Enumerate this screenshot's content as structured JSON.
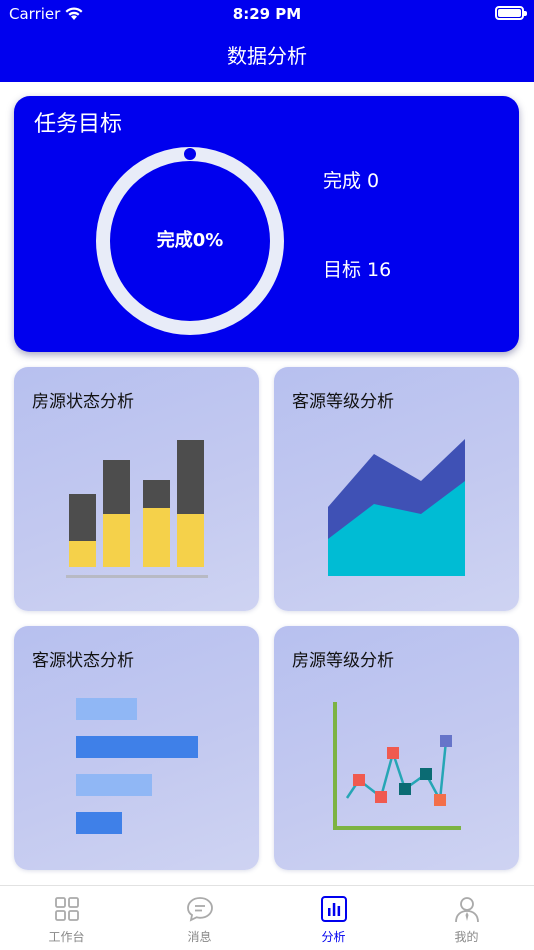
{
  "status_bar": {
    "carrier": "Carrier",
    "time": "8:29 PM"
  },
  "nav": {
    "title": "数据分析"
  },
  "colors": {
    "primary": "#0000ee",
    "card_bg": "#c3c9f0",
    "ring": "#e8ecf8"
  },
  "task_card": {
    "title": "任务目标",
    "progress_label": "完成0%",
    "progress_fraction": 0,
    "done_label": "完成 0",
    "target_label": "目标 16"
  },
  "cards": [
    {
      "title": "房源状态分析",
      "icon": "stacked-bar-chart-icon"
    },
    {
      "title": "客源等级分析",
      "icon": "area-chart-icon"
    },
    {
      "title": "客源状态分析",
      "icon": "horizontal-bar-chart-icon"
    },
    {
      "title": "房源等级分析",
      "icon": "line-chart-icon"
    }
  ],
  "tabs": [
    {
      "label": "工作台",
      "icon": "grid-icon",
      "active": false
    },
    {
      "label": "消息",
      "icon": "message-icon",
      "active": false
    },
    {
      "label": "分析",
      "icon": "bar-chart-icon",
      "active": true
    },
    {
      "label": "我的",
      "icon": "person-icon",
      "active": false
    }
  ]
}
